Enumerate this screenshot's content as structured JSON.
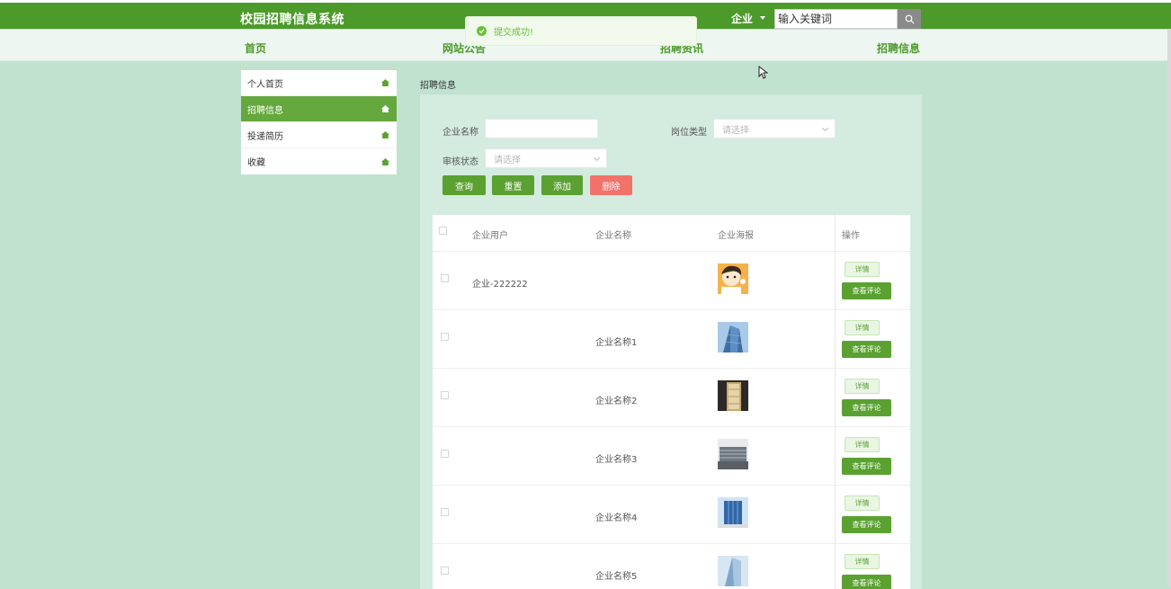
{
  "app": {
    "title": "校园招聘信息系统",
    "role": "企业",
    "search_placeholder": "输入关键词"
  },
  "nav": [
    "首页",
    "网站公告",
    "招聘资讯",
    "招聘信息"
  ],
  "toast": {
    "text": "提交成功!",
    "color": "#67c23a"
  },
  "sidebar": {
    "items": [
      {
        "label": "个人首页",
        "active": false
      },
      {
        "label": "招聘信息",
        "active": true
      },
      {
        "label": "投递简历",
        "active": false
      },
      {
        "label": "收藏",
        "active": false
      }
    ]
  },
  "breadcrumb": "招聘信息",
  "filters": {
    "company_name_label": "企业名称",
    "company_name_value": "",
    "job_type_label": "岗位类型",
    "job_type_placeholder": "请选择",
    "audit_label": "审核状态",
    "audit_placeholder": "请选择"
  },
  "actions": {
    "query": "查询",
    "reset": "重置",
    "add": "添加",
    "delete": "删除"
  },
  "table": {
    "headers": [
      "企业用户",
      "企业名称",
      "企业海报",
      "操作"
    ],
    "rows": [
      {
        "user": "企业-222222",
        "name": "",
        "poster": "cartoon-avatar"
      },
      {
        "user": "",
        "name": "企业名称1",
        "poster": "building-blue"
      },
      {
        "user": "",
        "name": "企业名称2",
        "poster": "building-dark"
      },
      {
        "user": "",
        "name": "企业名称3",
        "poster": "building-wide"
      },
      {
        "user": "",
        "name": "企业名称4",
        "poster": "building-tower"
      },
      {
        "user": "",
        "name": "企业名称5",
        "poster": "building-glass"
      }
    ],
    "detail_label": "详情",
    "comment_label": "查看评论"
  },
  "colors": {
    "brand": "#4c9a2a",
    "background": "#c1e2cf",
    "danger": "#f2726a"
  }
}
